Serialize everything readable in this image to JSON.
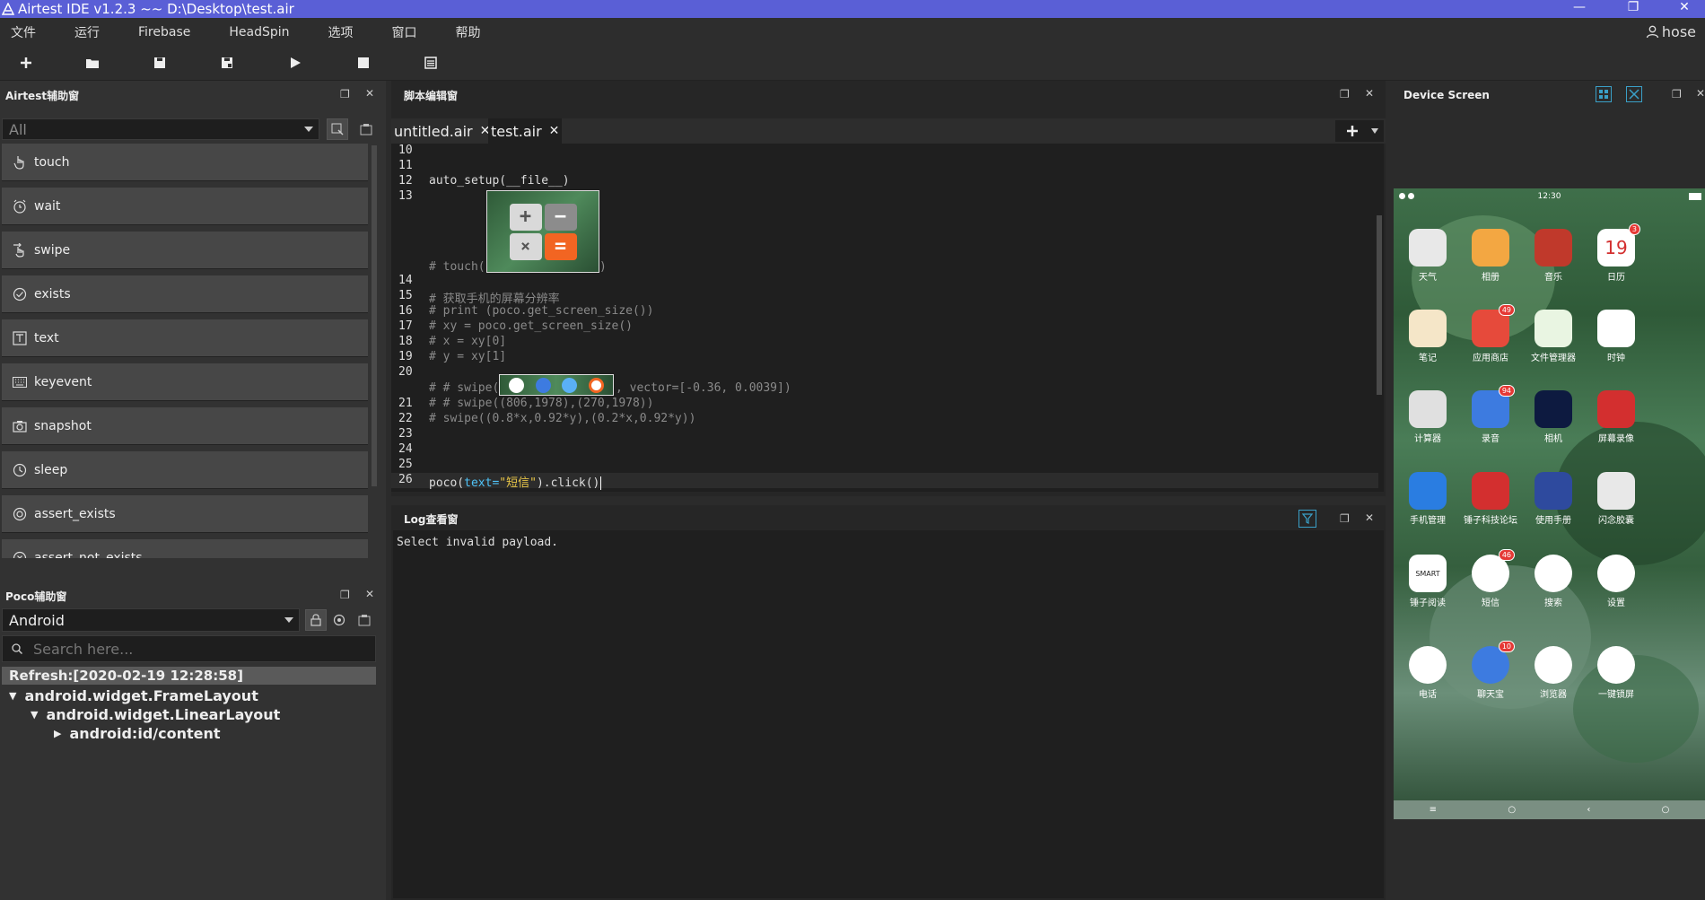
{
  "window": {
    "title": "Airtest IDE v1.2.3 ~~ D:\\Desktop\\test.air",
    "minimize": "—",
    "restore": "❐",
    "close": "✕"
  },
  "menu": {
    "items": [
      "文件",
      "运行",
      "Firebase",
      "HeadSpin",
      "选项",
      "窗口",
      "帮助"
    ],
    "user": "hose"
  },
  "airtest_panel": {
    "title": "Airtest辅助窗",
    "filter_value": "All",
    "items": [
      "touch",
      "wait",
      "swipe",
      "exists",
      "text",
      "keyevent",
      "snapshot",
      "sleep",
      "assert_exists",
      "assert_not_exists"
    ]
  },
  "poco_panel": {
    "title": "Poco辅助窗",
    "platform": "Android",
    "search_placeholder": "Search here...",
    "refresh": "Refresh:[2020-02-19 12:28:58]",
    "tree": [
      "android.widget.FrameLayout",
      "android.widget.LinearLayout",
      "android:id/content"
    ]
  },
  "editor": {
    "title": "脚本编辑窗",
    "tabs": [
      "untitled.air",
      "test.air"
    ],
    "line_numbers": [
      "10",
      "11",
      "12",
      "13",
      "14",
      "15",
      "16",
      "17",
      "18",
      "19",
      "20",
      "21",
      "22",
      "23",
      "24",
      "25",
      "26"
    ],
    "code": {
      "l12": "auto_setup(__file__)",
      "l13_prefix": "# touch(",
      "l13_suffix": ")",
      "l15": "# 获取手机的屏幕分辨率",
      "l16": "# print (poco.get_screen_size())",
      "l17": "# xy = poco.get_screen_size()",
      "l18": "# x = xy[0]",
      "l19": "# y = xy[1]",
      "l20_prefix": "# # swipe(",
      "l20_suffix": ", vector=[-0.36, 0.0039])",
      "l21": "# # swipe((806,1978),(270,1978))",
      "l22": "# swipe((0.8*x,0.92*y),(0.2*x,0.92*y))",
      "l26_a": "poco(",
      "l26_b": "text=",
      "l26_c": "\"短信\"",
      "l26_d": ").click()"
    }
  },
  "log_panel": {
    "title": "Log查看窗",
    "message": "Select invalid payload."
  },
  "device_panel": {
    "title": "Device Screen",
    "status_time": "12:30",
    "apps": [
      {
        "label": "天气",
        "badge": ""
      },
      {
        "label": "相册",
        "badge": ""
      },
      {
        "label": "音乐",
        "badge": ""
      },
      {
        "label": "日历",
        "badge": "3",
        "text": "19"
      },
      {
        "label": "笔记",
        "badge": ""
      },
      {
        "label": "应用商店",
        "badge": "49"
      },
      {
        "label": "文件管理器",
        "badge": ""
      },
      {
        "label": "时钟",
        "badge": ""
      },
      {
        "label": "计算器",
        "badge": ""
      },
      {
        "label": "录音",
        "badge": "94"
      },
      {
        "label": "相机",
        "badge": ""
      },
      {
        "label": "屏幕录像",
        "badge": ""
      },
      {
        "label": "手机管理",
        "badge": ""
      },
      {
        "label": "锤子科技论坛",
        "badge": ""
      },
      {
        "label": "使用手册",
        "badge": ""
      },
      {
        "label": "闪念胶囊",
        "badge": ""
      },
      {
        "label": "锤子阅读",
        "badge": "",
        "text": "SMART"
      },
      {
        "label": "短信",
        "badge": "46"
      },
      {
        "label": "搜索",
        "badge": ""
      },
      {
        "label": "设置",
        "badge": ""
      },
      {
        "label": "电话",
        "badge": ""
      },
      {
        "label": "聊天宝",
        "badge": "10"
      },
      {
        "label": "浏览器",
        "badge": ""
      },
      {
        "label": "一键锁屏",
        "badge": ""
      }
    ],
    "nav": [
      "≡",
      "○",
      "‹",
      "○"
    ]
  }
}
